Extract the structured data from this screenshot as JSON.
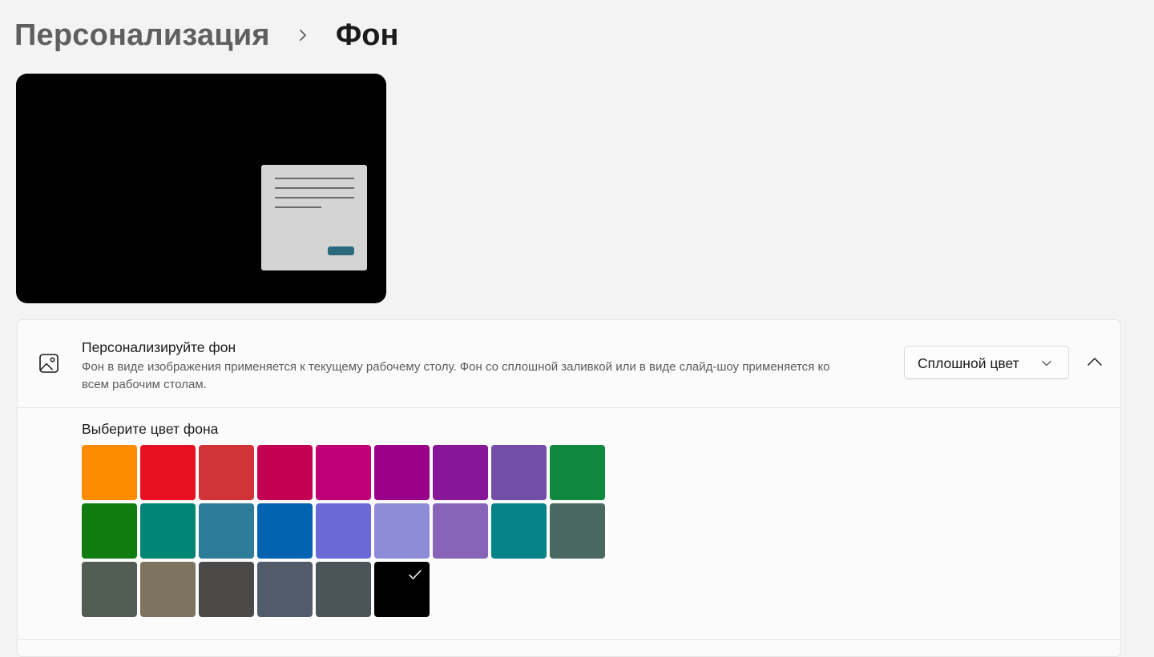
{
  "breadcrumb": {
    "parent": "Персонализация",
    "current": "Фон"
  },
  "background_card": {
    "title": "Персонализируйте фон",
    "description": "Фон в виде изображения применяется к текущему рабочему столу. Фон со сплошной заливкой или в виде слайд-шоу применяется ко всем рабочим столам.",
    "dropdown_value": "Сплошной цвет",
    "expanded": true
  },
  "color_picker": {
    "label": "Выберите цвет фона",
    "selected_index": 23,
    "colors": [
      "#ff8c00",
      "#e81123",
      "#d13438",
      "#c30052",
      "#bf0077",
      "#9a0089",
      "#881798",
      "#744da9",
      "#10893e",
      "#107c10",
      "#018574",
      "#2d7d9a",
      "#0063b1",
      "#6b69d6",
      "#8e8cd8",
      "#8764b8",
      "#038387",
      "#486860",
      "#525e54",
      "#7e735f",
      "#4c4a48",
      "#515c6b",
      "#4a5459",
      "#000000"
    ]
  },
  "colors": {
    "page_bg": "#f3f3f3",
    "card_bg": "#fbfbfb",
    "preview_accent": "#2b6a7c"
  },
  "icons": {
    "breadcrumb_separator": "chevron-right-icon",
    "card_icon": "picture-icon",
    "dropdown": "chevron-down-icon",
    "collapse": "chevron-up-icon",
    "selected": "checkmark-icon"
  }
}
